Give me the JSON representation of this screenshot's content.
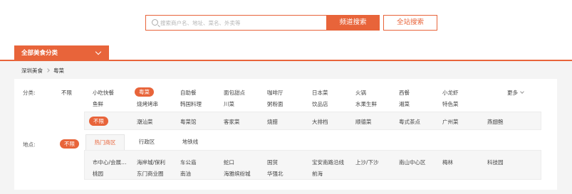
{
  "search": {
    "placeholder": "搜索商户名、地址、菜名、外卖等",
    "channel_label": "频道搜索",
    "site_label": "全站搜索"
  },
  "nav": {
    "category_label": "全部美食分类"
  },
  "breadcrumb": {
    "root": "深圳美食",
    "current": "粤菜"
  },
  "filters": {
    "category": {
      "label": "分类:",
      "any": "不限",
      "row1": [
        "小吃快餐",
        "粤菜",
        "自助餐",
        "面包甜点",
        "咖啡厅",
        "日本菜",
        "火锅",
        "西餐",
        "小龙虾"
      ],
      "more": "更多",
      "row2": [
        "鱼鲜",
        "烧烤烤串",
        "韩国料理",
        "川菜",
        "粥粉面",
        "饮品店",
        "水果生鲜",
        "湘菜",
        "特色菜"
      ],
      "sub_any": "不限",
      "sub": [
        "潮汕菜",
        "粤菜馆",
        "客家菜",
        "烧腊",
        "大排档",
        "顺德菜",
        "粤式茶点",
        "广州菜",
        "燕翅鲍"
      ]
    },
    "location": {
      "label": "地点:",
      "any": "不限",
      "tabs": [
        "热门商区",
        "行政区",
        "地铁线"
      ],
      "row1": [
        "市中心/会展…",
        "海岸城/保利",
        "车公庙",
        "蛇口",
        "国贸",
        "宝安南路沿线",
        "上沙/下沙",
        "南山中心区",
        "梅林",
        "科技园"
      ],
      "row2": [
        "桃园",
        "东门商业圈",
        "南油",
        "海雅缤纷城",
        "华强北",
        "前海"
      ]
    }
  },
  "colors": {
    "accent": "#e8643a"
  }
}
